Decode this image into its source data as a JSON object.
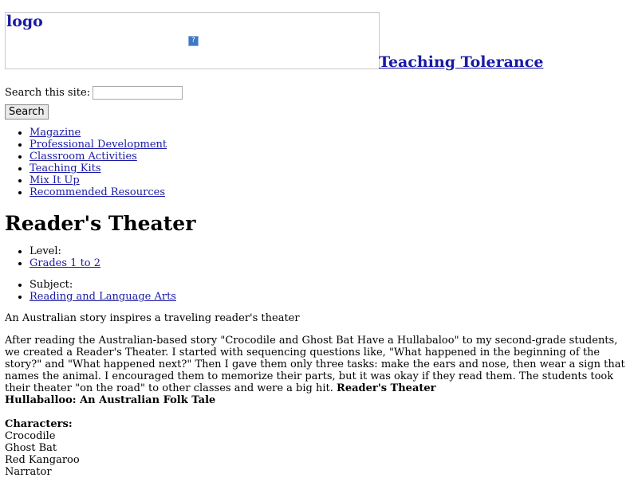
{
  "header": {
    "logo_text": "logo",
    "broken_image_glyph": "?",
    "site_name": "Teaching Tolerance"
  },
  "search": {
    "label": "Search this site:",
    "input_value": "",
    "button_label": "Search"
  },
  "nav": {
    "items": [
      {
        "label": "Magazine"
      },
      {
        "label": "Professional Development"
      },
      {
        "label": "Classroom Activities"
      },
      {
        "label": "Teaching Kits"
      },
      {
        "label": "Mix It Up"
      },
      {
        "label": "Recommended Resources"
      }
    ]
  },
  "article": {
    "title": "Reader's Theater",
    "level_label": "Level:",
    "level_value": "Grades 1 to 2",
    "subject_label": "Subject:",
    "subject_value": "Reading and Language Arts",
    "summary": "An Australian story inspires a traveling reader's theater",
    "body": "After reading the Australian-based story \"Crocodile and Ghost Bat Have a Hullabaloo\" to my second-grade students, we created a Reader's Theater. I started with sequencing questions like, \"What happened in the beginning of the story?\" and \"What happened next?\" Then I gave them only three tasks: make the ears and nose, then wear a sign that names the animal. I encouraged them to memorize their parts, but it was okay if they read them. The students took their theater \"on the road\" to other classes and were a big hit.",
    "bold_heading_1": "Reader's Theater",
    "bold_heading_2": "Hullaballoo: An Australian Folk Tale",
    "characters_heading": "Characters:",
    "characters": [
      "Crocodile",
      "Ghost Bat",
      "Red Kangaroo",
      "Narrator"
    ]
  }
}
